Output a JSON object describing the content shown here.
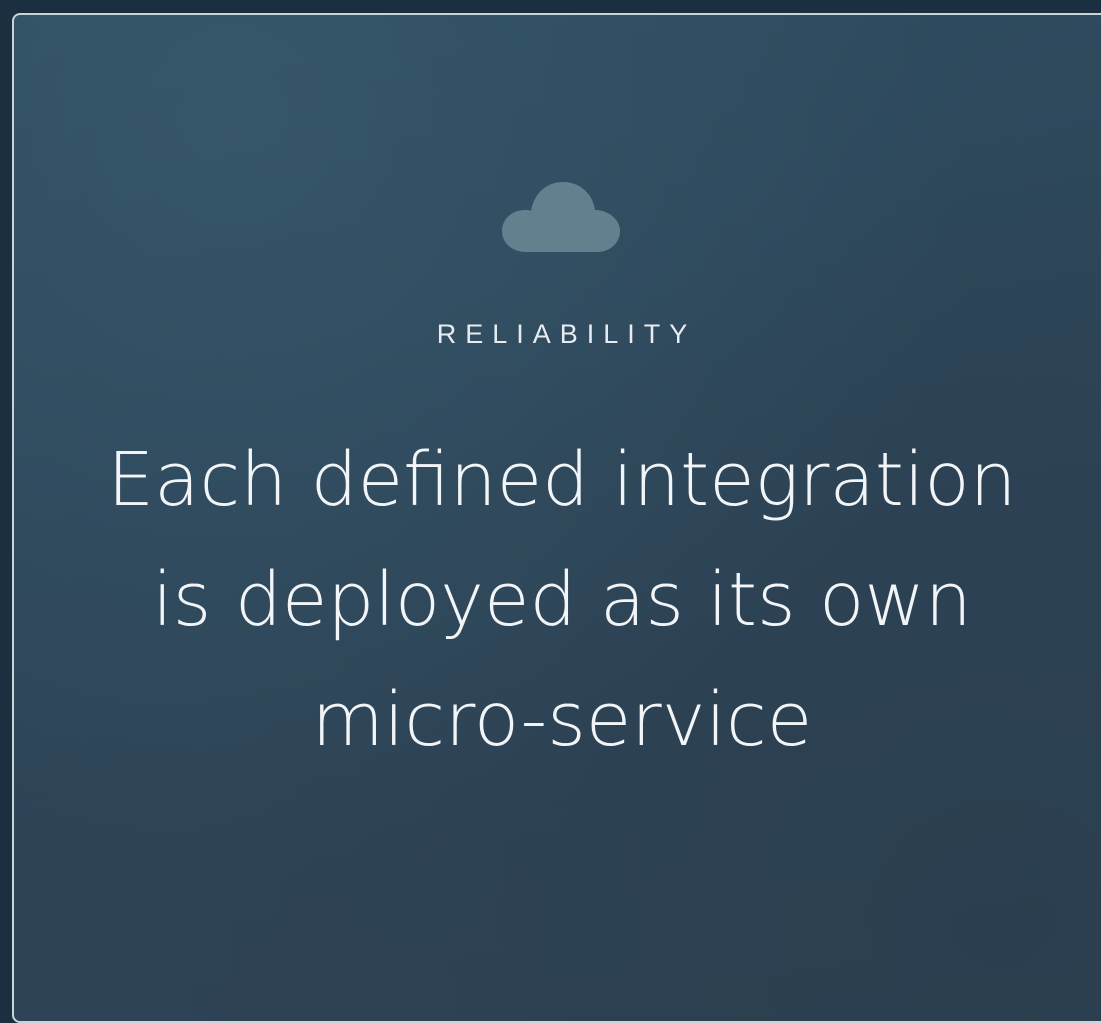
{
  "card": {
    "icon": "cloud-icon",
    "eyebrow": "RELIABILITY",
    "headline": "Each defined integration is deployed as its own micro-service"
  },
  "colors": {
    "background": "#2e4a5c",
    "border": "#c9d3da",
    "icon": "#62808d",
    "text": "#f2f5f7"
  }
}
